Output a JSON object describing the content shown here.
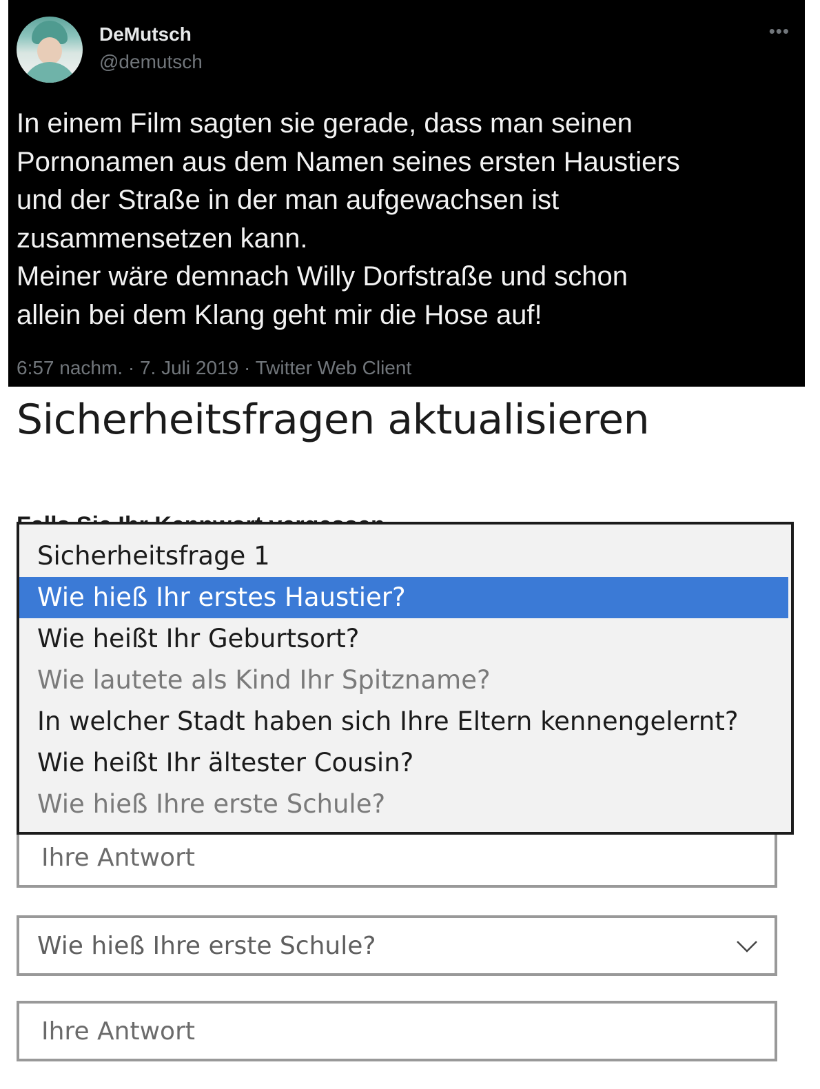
{
  "tweet": {
    "display_name": "DeMutsch",
    "handle": "@demutsch",
    "more_glyph": "•••",
    "text": "In einem Film sagten sie gerade, dass man seinen\nPornonamen aus dem Namen seines ersten Haustiers\nund der Straße in der man aufgewachsen ist\nzusammensetzen kann.\nMeiner wäre demnach Willy Dorfstraße und schon\nallein bei dem Klang geht mir die Hose auf!",
    "meta": "6:57 nachm. · 7. Juli 2019 · Twitter Web Client",
    "icons": {
      "avatar": "profile-photo",
      "more": "more-horizontal-icon"
    },
    "colors": {
      "background": "#000000",
      "text": "#e7e9ea",
      "muted": "#71767b"
    }
  },
  "form": {
    "title": "Sicherheitsfragen aktualisieren",
    "hint_partial": "Falls Sie Ihr Kennwort vergessen",
    "dropdown_options": [
      {
        "label": "Sicherheitsfrage 1",
        "state": "normal"
      },
      {
        "label": "Wie hieß Ihr erstes Haustier?",
        "state": "selected"
      },
      {
        "label": "Wie heißt Ihr Geburtsort?",
        "state": "normal"
      },
      {
        "label": "Wie lautete als Kind Ihr Spitzname?",
        "state": "dim"
      },
      {
        "label": "In welcher Stadt haben sich Ihre Eltern kennengelernt?",
        "state": "normal"
      },
      {
        "label": "Wie heißt Ihr ältester Cousin?",
        "state": "normal"
      },
      {
        "label": "Wie hieß Ihre erste Schule?",
        "state": "dim"
      }
    ],
    "answer1_placeholder": "Ihre Antwort",
    "question2_selected": "Wie hieß Ihre erste Schule?",
    "answer2_placeholder": "Ihre Antwort",
    "icons": {
      "select_arrow": "chevron-down-icon"
    },
    "colors": {
      "selection": "#3b7ad6",
      "dropdown_bg": "#f2f2f2",
      "border": "#999999"
    }
  }
}
